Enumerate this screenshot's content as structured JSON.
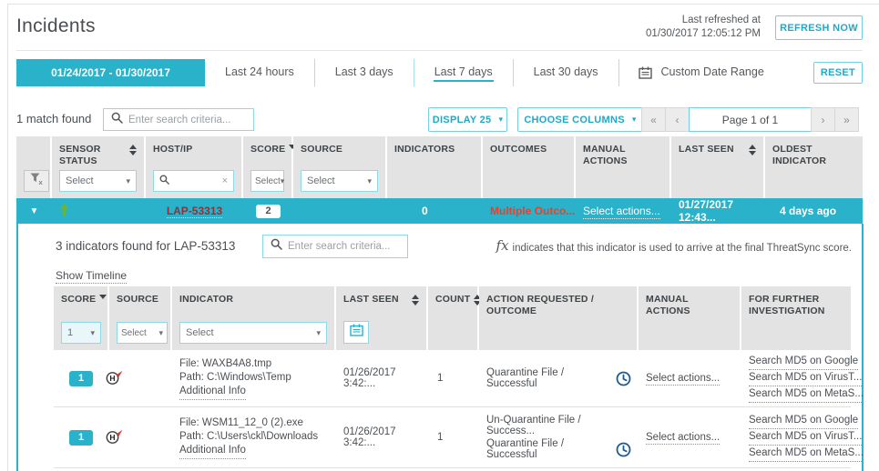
{
  "page": {
    "title": "Incidents",
    "last_refreshed_label": "Last refreshed at",
    "last_refreshed_value": "01/30/2017 12:05:12 PM",
    "refresh_button": "REFRESH NOW",
    "reset_button": "RESET"
  },
  "colors": {
    "accent": "#29b2ca",
    "outcome_red": "#e8402a",
    "host_maroon": "#8f3237",
    "status_green": "#6cb52d",
    "clock_navy": "#1d5a96"
  },
  "tabs": {
    "active_range": "01/24/2017 - 01/30/2017",
    "items": [
      "Last 24 hours",
      "Last 3 days",
      "Last 7 days",
      "Last 30 days"
    ],
    "custom": "Custom Date Range",
    "selected": "Last 7 days"
  },
  "toolbar": {
    "match_count": "1 match found",
    "search_placeholder": "Enter search criteria...",
    "display_button": "DISPLAY 25",
    "choose_columns_button": "CHOOSE COLUMNS",
    "pagination": {
      "first": "«",
      "prev": "‹",
      "label": "Page 1 of 1",
      "next": "›",
      "last": "»"
    }
  },
  "filters": {
    "select_placeholder": "Select"
  },
  "incidents_table": {
    "columns": [
      "SENSOR STATUS",
      "HOST/IP",
      "SCORE",
      "SOURCE",
      "INDICATORS",
      "OUTCOMES",
      "MANUAL ACTIONS",
      "LAST SEEN",
      "OLDEST INDICATOR"
    ],
    "row": {
      "host": "LAP-53313",
      "score": "2",
      "indicators": "0",
      "outcomes": "Multiple Outco...",
      "manual_actions": "Select actions...",
      "last_seen": "01/27/2017 12:43...",
      "oldest_indicator": "4 days ago"
    }
  },
  "details": {
    "title": "3 indicators found for LAP-53313",
    "search_placeholder": "Enter search criteria...",
    "fx_symbol": "fx",
    "fx_note": "indicates that this indicator is used to arrive at the final ThreatSync score.",
    "show_timeline": "Show Timeline"
  },
  "indicators_table": {
    "columns": [
      "SCORE",
      "SOURCE",
      "INDICATOR",
      "LAST SEEN",
      "COUNT",
      "ACTION REQUESTED / OUTCOME",
      "MANUAL ACTIONS",
      "FOR FURTHER INVESTIGATION"
    ],
    "score_filter_value": "1",
    "rows": [
      {
        "score": "1",
        "file": "File: WAXB4A8.tmp",
        "path": "Path: C:\\Windows\\Temp",
        "additional_info": "Additional Info",
        "last_seen": "01/26/2017 3:42:...",
        "count": "1",
        "actions": [
          "Quarantine File / Successful"
        ],
        "manual_actions": "Select actions...",
        "investigation": [
          "Search MD5 on Google",
          "Search MD5 on VirusT...",
          "Search MD5 on MetaS..."
        ]
      },
      {
        "score": "1",
        "file": "File: WSM11_12_0 (2).exe",
        "path": "Path: C:\\Users\\ckl\\Downloads",
        "additional_info": "Additional Info",
        "last_seen": "01/26/2017 3:42:...",
        "count": "1",
        "actions": [
          "Un-Quarantine File / Success...",
          "Quarantine File / Successful"
        ],
        "manual_actions": "Select actions...",
        "investigation": [
          "Search MD5 on Google",
          "Search MD5 on VirusT...",
          "Search MD5 on MetaS..."
        ]
      }
    ]
  }
}
